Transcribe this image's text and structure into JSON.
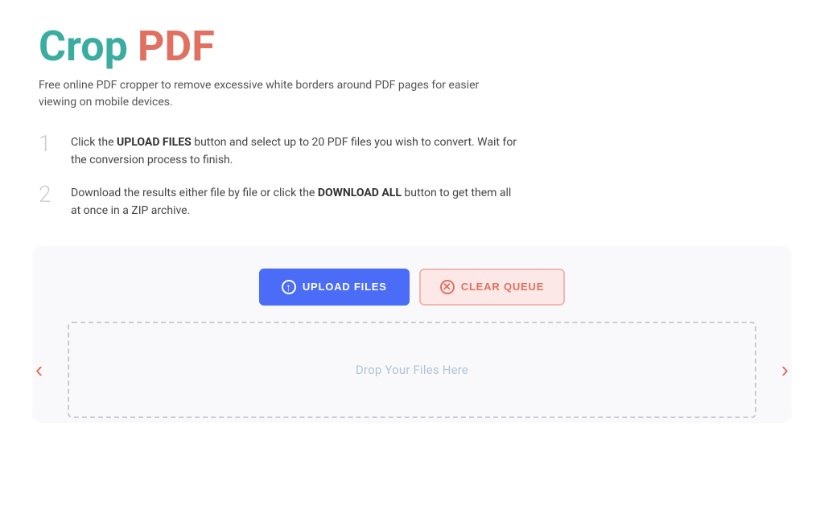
{
  "header": {
    "title_crop": "Crop",
    "title_pdf": "PDF"
  },
  "subtitle": "Free online PDF cropper to remove excessive white borders around PDF pages for easier viewing on mobile devices.",
  "steps": [
    {
      "number": "1",
      "text_before": "Click the ",
      "bold1": "UPLOAD FILES",
      "text_mid": " button and select up to 20 PDF files you wish to convert. Wait for the conversion process to finish.",
      "bold2": "",
      "text_after": ""
    },
    {
      "number": "2",
      "text_before": "Download the results either file by file or click the ",
      "bold1": "DOWNLOAD ALL",
      "text_mid": " button to get them all at once in a ZIP archive.",
      "bold2": "",
      "text_after": ""
    }
  ],
  "buttons": {
    "upload_label": "UPLOAD FILES",
    "clear_label": "CLEAR QUEUE"
  },
  "dropzone": {
    "placeholder": "Drop Your Files Here"
  },
  "carousel": {
    "left_arrow": "‹",
    "right_arrow": "›"
  }
}
